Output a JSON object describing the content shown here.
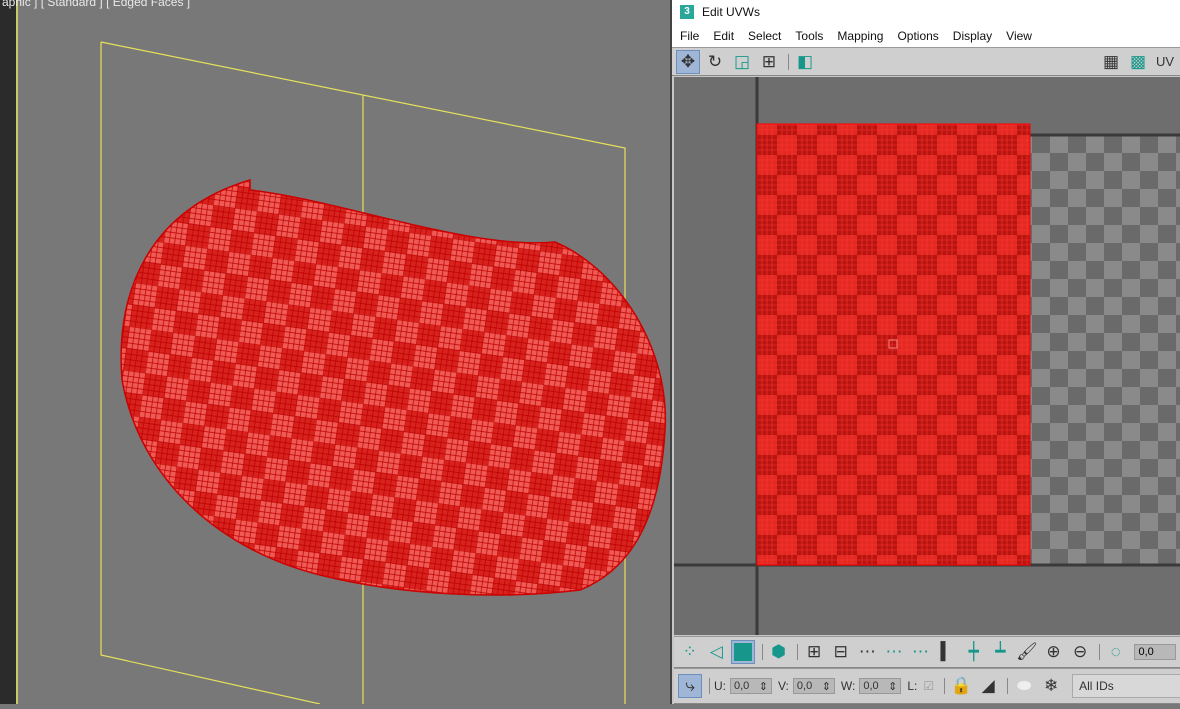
{
  "viewport": {
    "label": "aphic ] [ Standard ] [ Edged Faces ]"
  },
  "window": {
    "title": "Edit UVWs",
    "app_icon": "3"
  },
  "menu": [
    "File",
    "Edit",
    "Select",
    "Tools",
    "Mapping",
    "Options",
    "Display",
    "View"
  ],
  "toolbar": {
    "uv_label": "UV"
  },
  "status": {
    "u_label": "U:",
    "u": "0,0",
    "v_label": "V:",
    "v": "0,0",
    "w_label": "W:",
    "w": "0,0",
    "l_label": "L:",
    "soft": "0,0",
    "ids": "All IDs"
  },
  "colors": {
    "mesh": "#e8201c",
    "plane": "#e6e05a",
    "accent": "#17978b"
  }
}
